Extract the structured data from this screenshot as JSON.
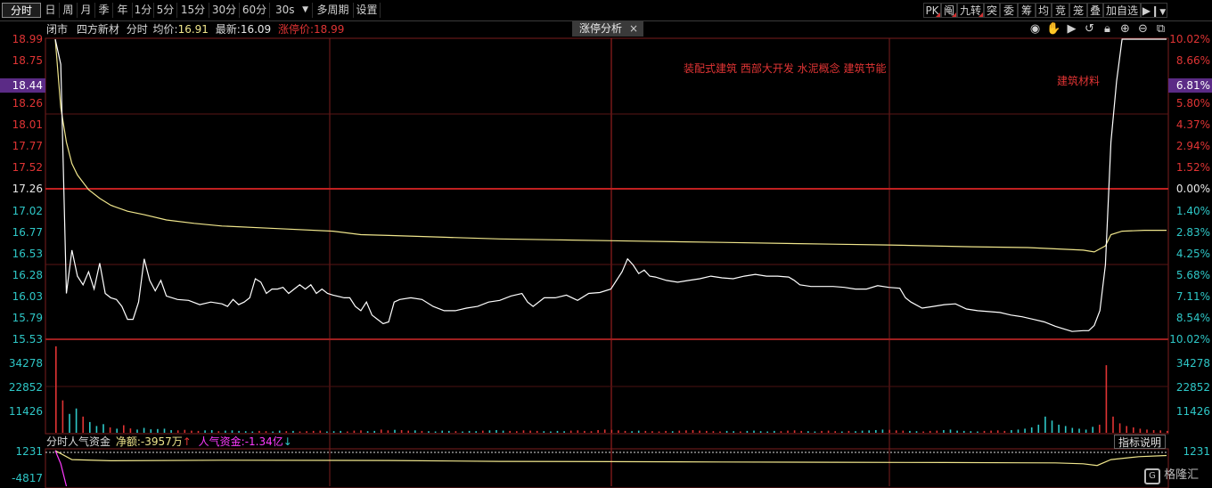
{
  "toolbar": {
    "periods": [
      "分时",
      "日",
      "周",
      "月",
      "季",
      "年",
      "1分",
      "5分",
      "15分",
      "30分",
      "60分",
      "30s",
      "多周期",
      "设置"
    ],
    "active_period": "分时",
    "right_tools": [
      "PK",
      "阄",
      "九转",
      "突",
      "委",
      "筹",
      "均",
      "竞",
      "笼",
      "叠",
      "加自选"
    ]
  },
  "info": {
    "status": "闭市",
    "name": "四方新材",
    "mode": "分时",
    "avg_label": "均价:",
    "avg_value": "16.91",
    "last_label": "最新:",
    "last_value": "16.09",
    "limit_label": "涨停价:",
    "limit_value": "18.99"
  },
  "tab": {
    "label": "涨停分析",
    "close": "×"
  },
  "sectors": {
    "line1": "装配式建筑  西部大开发  水泥概念  建筑节能",
    "line2": "建筑材料"
  },
  "left_price_labels": [
    "18.99",
    "18.75",
    "18.44",
    "18.26",
    "18.01",
    "17.77",
    "17.52",
    "17.26",
    "17.02",
    "16.77",
    "16.53",
    "16.28",
    "16.03",
    "15.79",
    "15.53"
  ],
  "right_pct_labels": [
    "10.02%",
    "8.66%",
    "6.81%",
    "5.80%",
    "4.37%",
    "2.94%",
    "1.52%",
    "0.00%",
    "1.40%",
    "2.83%",
    "4.25%",
    "5.68%",
    "7.11%",
    "8.54%",
    "10.02%"
  ],
  "volume_labels": [
    "34278",
    "22852",
    "11426"
  ],
  "fund_labels": [
    "1231",
    "-4817"
  ],
  "fund": {
    "title": "分时人气资金",
    "net_label": "净额:",
    "net_value": "-3957万",
    "net_arrow": "↑",
    "pop_label": "人气资金:",
    "pop_value": "-1.34亿",
    "pop_arrow": "↓",
    "explain": "指标说明"
  },
  "logo": {
    "text": "格隆汇"
  },
  "colors": {
    "up": "#e03434",
    "down": "#2ec7c7",
    "price_line": "#ffffff",
    "avg_line": "#f0e68c",
    "highlight": "#5b2b86"
  },
  "chart_data": {
    "type": "line",
    "prev_close": 17.26,
    "ylim": [
      15.53,
      18.99
    ],
    "price": [
      [
        0,
        18.99
      ],
      [
        2,
        18.7
      ],
      [
        4,
        16.05
      ],
      [
        6,
        16.55
      ],
      [
        8,
        16.25
      ],
      [
        10,
        16.15
      ],
      [
        12,
        16.3
      ],
      [
        14,
        16.1
      ],
      [
        16,
        16.4
      ],
      [
        18,
        16.05
      ],
      [
        20,
        16.0
      ],
      [
        22,
        15.98
      ],
      [
        24,
        15.9
      ],
      [
        26,
        15.75
      ],
      [
        28,
        15.75
      ],
      [
        30,
        15.95
      ],
      [
        32,
        16.45
      ],
      [
        34,
        16.2
      ],
      [
        36,
        16.08
      ],
      [
        38,
        16.2
      ],
      [
        40,
        16.02
      ],
      [
        44,
        15.98
      ],
      [
        48,
        15.97
      ],
      [
        52,
        15.92
      ],
      [
        56,
        15.95
      ],
      [
        60,
        15.93
      ],
      [
        62,
        15.9
      ],
      [
        64,
        15.98
      ],
      [
        66,
        15.92
      ],
      [
        68,
        15.95
      ],
      [
        70,
        16.0
      ],
      [
        72,
        16.22
      ],
      [
        74,
        16.18
      ],
      [
        76,
        16.05
      ],
      [
        78,
        16.1
      ],
      [
        80,
        16.1
      ],
      [
        82,
        16.12
      ],
      [
        84,
        16.05
      ],
      [
        86,
        16.1
      ],
      [
        88,
        16.15
      ],
      [
        90,
        16.1
      ],
      [
        92,
        16.15
      ],
      [
        94,
        16.05
      ],
      [
        96,
        16.1
      ],
      [
        98,
        16.05
      ],
      [
        100,
        16.03
      ],
      [
        104,
        16.0
      ],
      [
        106,
        16.0
      ],
      [
        108,
        15.9
      ],
      [
        110,
        15.85
      ],
      [
        112,
        15.95
      ],
      [
        114,
        15.8
      ],
      [
        116,
        15.75
      ],
      [
        118,
        15.7
      ],
      [
        120,
        15.72
      ],
      [
        122,
        15.95
      ],
      [
        124,
        15.98
      ],
      [
        128,
        16.0
      ],
      [
        132,
        15.98
      ],
      [
        136,
        15.9
      ],
      [
        140,
        15.85
      ],
      [
        144,
        15.85
      ],
      [
        148,
        15.88
      ],
      [
        152,
        15.9
      ],
      [
        156,
        15.95
      ],
      [
        160,
        15.97
      ],
      [
        164,
        16.02
      ],
      [
        168,
        16.05
      ],
      [
        170,
        15.95
      ],
      [
        172,
        15.9
      ],
      [
        176,
        16.0
      ],
      [
        180,
        16.0
      ],
      [
        184,
        16.03
      ],
      [
        188,
        15.97
      ],
      [
        192,
        16.05
      ],
      [
        196,
        16.06
      ],
      [
        200,
        16.1
      ],
      [
        204,
        16.3
      ],
      [
        206,
        16.45
      ],
      [
        208,
        16.38
      ],
      [
        210,
        16.28
      ],
      [
        212,
        16.32
      ],
      [
        214,
        16.25
      ],
      [
        216,
        16.24
      ],
      [
        220,
        16.2
      ],
      [
        224,
        16.18
      ],
      [
        228,
        16.2
      ],
      [
        232,
        16.22
      ],
      [
        236,
        16.25
      ],
      [
        240,
        16.23
      ],
      [
        244,
        16.22
      ],
      [
        248,
        16.25
      ],
      [
        252,
        16.27
      ],
      [
        256,
        16.25
      ],
      [
        260,
        16.25
      ],
      [
        264,
        16.24
      ],
      [
        266,
        16.2
      ],
      [
        268,
        16.15
      ],
      [
        272,
        16.13
      ],
      [
        276,
        16.13
      ],
      [
        280,
        16.13
      ],
      [
        284,
        16.12
      ],
      [
        288,
        16.1
      ],
      [
        292,
        16.1
      ],
      [
        296,
        16.14
      ],
      [
        300,
        16.12
      ],
      [
        304,
        16.11
      ],
      [
        306,
        16.0
      ],
      [
        308,
        15.95
      ],
      [
        312,
        15.88
      ],
      [
        316,
        15.9
      ],
      [
        320,
        15.92
      ],
      [
        324,
        15.93
      ],
      [
        328,
        15.87
      ],
      [
        332,
        15.85
      ],
      [
        336,
        15.84
      ],
      [
        340,
        15.83
      ],
      [
        344,
        15.8
      ],
      [
        348,
        15.78
      ],
      [
        352,
        15.75
      ],
      [
        356,
        15.72
      ],
      [
        360,
        15.67
      ],
      [
        364,
        15.63
      ],
      [
        366,
        15.61
      ],
      [
        370,
        15.62
      ],
      [
        372,
        15.62
      ],
      [
        374,
        15.68
      ],
      [
        376,
        15.85
      ],
      [
        378,
        16.38
      ],
      [
        380,
        17.8
      ],
      [
        382,
        18.5
      ],
      [
        384,
        18.99
      ],
      [
        400,
        18.99
      ]
    ],
    "avg": [
      [
        0,
        18.99
      ],
      [
        2,
        18.2
      ],
      [
        4,
        17.8
      ],
      [
        6,
        17.55
      ],
      [
        8,
        17.42
      ],
      [
        12,
        17.25
      ],
      [
        16,
        17.15
      ],
      [
        20,
        17.07
      ],
      [
        26,
        17.0
      ],
      [
        32,
        16.96
      ],
      [
        40,
        16.9
      ],
      [
        50,
        16.86
      ],
      [
        60,
        16.83
      ],
      [
        80,
        16.8
      ],
      [
        100,
        16.77
      ],
      [
        110,
        16.73
      ],
      [
        120,
        16.72
      ],
      [
        140,
        16.7
      ],
      [
        160,
        16.68
      ],
      [
        180,
        16.67
      ],
      [
        200,
        16.66
      ],
      [
        240,
        16.64
      ],
      [
        280,
        16.62
      ],
      [
        300,
        16.61
      ],
      [
        330,
        16.59
      ],
      [
        350,
        16.58
      ],
      [
        370,
        16.55
      ],
      [
        374,
        16.53
      ],
      [
        378,
        16.6
      ],
      [
        380,
        16.73
      ],
      [
        384,
        16.77
      ],
      [
        392,
        16.78
      ],
      [
        400,
        16.78
      ]
    ],
    "volume_max": 34278,
    "volume": [
      32000,
      12000,
      7000,
      9000,
      6000,
      4000,
      2500,
      3200,
      2000,
      1500,
      2800,
      1600,
      1200,
      1800,
      1300,
      1400,
      1500,
      1000,
      900,
      1100,
      800,
      700,
      900,
      1000,
      600,
      800,
      900,
      700,
      600,
      500,
      700,
      600,
      500,
      800,
      600,
      700,
      500,
      600,
      700,
      800,
      500,
      600,
      700,
      500,
      800,
      900,
      600,
      700,
      1200,
      900,
      1100,
      1000,
      800,
      900,
      700,
      600,
      500,
      800,
      700,
      600,
      500,
      700,
      600,
      800,
      900,
      1000,
      800,
      700,
      600,
      900,
      800,
      700,
      600,
      500,
      700,
      600,
      800,
      900,
      700,
      600,
      1000,
      1200,
      1100,
      900,
      700,
      600,
      800,
      700,
      600,
      500,
      700,
      600,
      800,
      900,
      1000,
      800,
      700,
      600,
      500,
      700,
      600,
      500,
      700,
      800,
      600,
      500,
      700,
      600,
      800,
      900,
      700,
      600,
      500,
      700,
      800,
      600,
      500,
      700,
      600,
      800,
      900,
      1000,
      1200,
      1100,
      900,
      800,
      700,
      600,
      500,
      700,
      800,
      1000,
      1200,
      800,
      700,
      600,
      500,
      700,
      800,
      900,
      700,
      1000,
      1200,
      1500,
      2000,
      3000,
      6000,
      4500,
      3000,
      2500,
      1800,
      1500,
      1200,
      2200,
      3000,
      25000,
      6000,
      3500,
      2500,
      2000,
      1500,
      1200,
      1000,
      900,
      700
    ],
    "fund_ylim": [
      -4817,
      1231
    ],
    "fund": [
      [
        0,
        1231
      ],
      [
        6,
        -300
      ],
      [
        20,
        -500
      ],
      [
        60,
        -400
      ],
      [
        120,
        -450
      ],
      [
        160,
        -600
      ],
      [
        200,
        -650
      ],
      [
        240,
        -700
      ],
      [
        280,
        -750
      ],
      [
        320,
        -800
      ],
      [
        360,
        -850
      ],
      [
        370,
        -1000
      ],
      [
        375,
        -1300
      ],
      [
        380,
        -300
      ],
      [
        390,
        200
      ],
      [
        400,
        400
      ]
    ],
    "fund_pink": [
      [
        0,
        1231
      ],
      [
        2,
        -1000
      ],
      [
        4,
        -4817
      ]
    ]
  }
}
